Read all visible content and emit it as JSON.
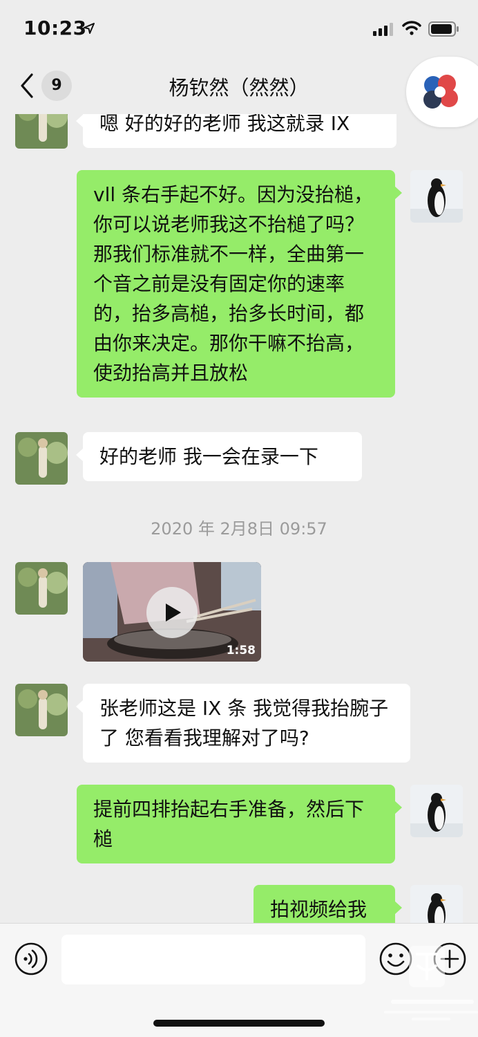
{
  "status_bar": {
    "time": "10:23"
  },
  "nav": {
    "unread_count": "9",
    "title": "杨钦然（然然）"
  },
  "messages": [
    {
      "side": "in",
      "text": "嗯 好的好的老师 我这就录 IX"
    },
    {
      "side": "out",
      "text": "vll 条右手起不好。因为没抬槌，你可以说老师我这不抬槌了吗？那我们标准就不一样，全曲第一个音之前是没有固定你的速率的，抬多高槌，抬多长时间，都由你来决定。那你干嘛不抬高，使劲抬高并且放松"
    },
    {
      "side": "in",
      "text": "好的老师 我一会在录一下"
    },
    {
      "side": "in",
      "text": "张老师这是 IX 条 我觉得我抬腕子了 您看看我理解对了吗?"
    },
    {
      "side": "out",
      "text": "提前四排抬起右手准备，然后下槌"
    },
    {
      "side": "out",
      "text": "拍视频给我"
    }
  ],
  "timestamp": "2020 年 2月8日 09:57",
  "video": {
    "duration": "1:58"
  },
  "input": {
    "value": ""
  },
  "icons": {
    "back": "chevron-left-icon",
    "voice": "voice-icon",
    "emoji": "emoji-icon",
    "plus": "plus-icon",
    "play": "play-icon",
    "location": "location-arrow-icon",
    "signal": "signal-icon",
    "wifi": "wifi-icon",
    "battery": "battery-icon"
  },
  "colors": {
    "outgoing_bubble": "#95ec69",
    "incoming_bubble": "#ffffff",
    "background": "#ededed"
  }
}
